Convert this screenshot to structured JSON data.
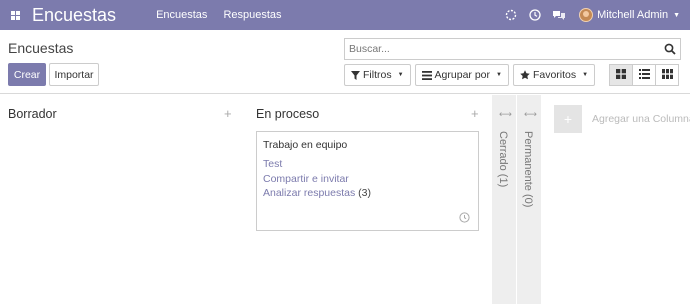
{
  "navbar": {
    "app_title": "Encuestas",
    "menu": [
      {
        "label": "Encuestas"
      },
      {
        "label": "Respuestas"
      }
    ],
    "user_name": "Mitchell Admin"
  },
  "control_panel": {
    "breadcrumb": "Encuestas",
    "create_label": "Crear",
    "import_label": "Importar",
    "search_placeholder": "Buscar...",
    "filters_label": "Filtros",
    "group_by_label": "Agrupar por",
    "favorites_label": "Favoritos",
    "active_view": "kanban"
  },
  "kanban": {
    "columns": [
      {
        "title": "Borrador"
      },
      {
        "title": "En proceso"
      }
    ],
    "card": {
      "title": "Trabajo en equipo",
      "links": [
        {
          "label": "Test"
        },
        {
          "label": "Compartir e invitar"
        },
        {
          "label": "Analizar respuestas",
          "count": "(3)"
        }
      ]
    },
    "folded_columns": [
      {
        "label": "Cerrado (1)"
      },
      {
        "label": "Permanente (0)"
      }
    ],
    "add_column_label": "Agregar una Columna"
  },
  "colors": {
    "brand": "#7c7bad",
    "link": "#7c7bad",
    "folded_bg": "#eeeeee"
  }
}
